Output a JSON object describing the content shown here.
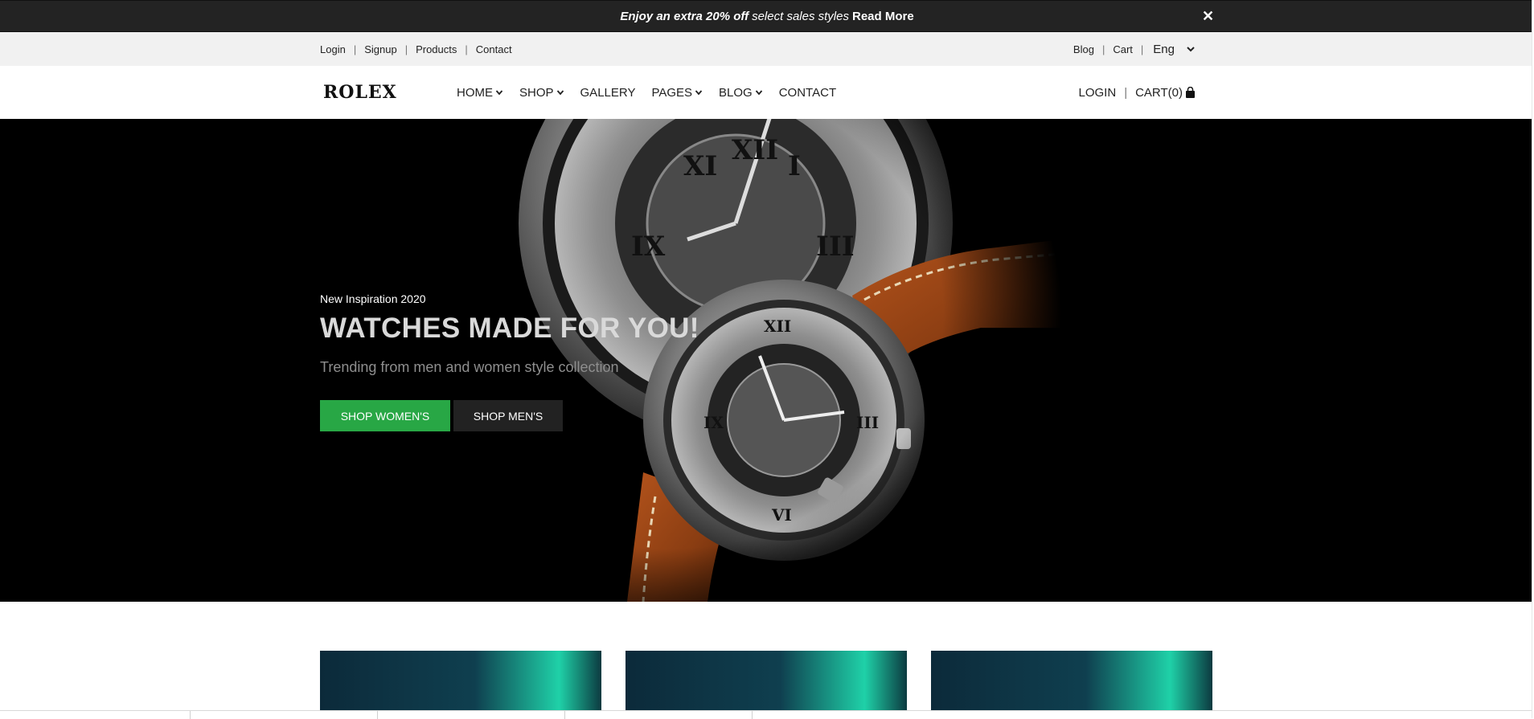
{
  "promo": {
    "bold_text": "Enjoy an extra 20% off",
    "italic_text": "select sales styles",
    "link_text": "Read More",
    "close_symbol": "✕"
  },
  "topbar": {
    "left_links": [
      "Login",
      "Signup",
      "Products",
      "Contact"
    ],
    "right_links": [
      "Blog",
      "Cart"
    ],
    "language": "Eng"
  },
  "nav": {
    "logo": "ROLEX",
    "menu": {
      "home": "HOME",
      "shop": "SHOP",
      "gallery": "GALLERY",
      "pages": "PAGES",
      "blog": "BLOG",
      "contact": "CONTACT"
    },
    "login": "LOGIN",
    "cart": "CART(0)"
  },
  "hero": {
    "subtitle": "New Inspiration 2020",
    "title": "WATCHES MADE FOR YOU!",
    "description": "Trending from men and women style collection",
    "btn_women": "SHOP WOMEN'S",
    "btn_men": "SHOP MEN'S"
  },
  "colors": {
    "accent_green": "#28a745",
    "promo_bg": "#232323",
    "hero_bg": "#000000"
  }
}
